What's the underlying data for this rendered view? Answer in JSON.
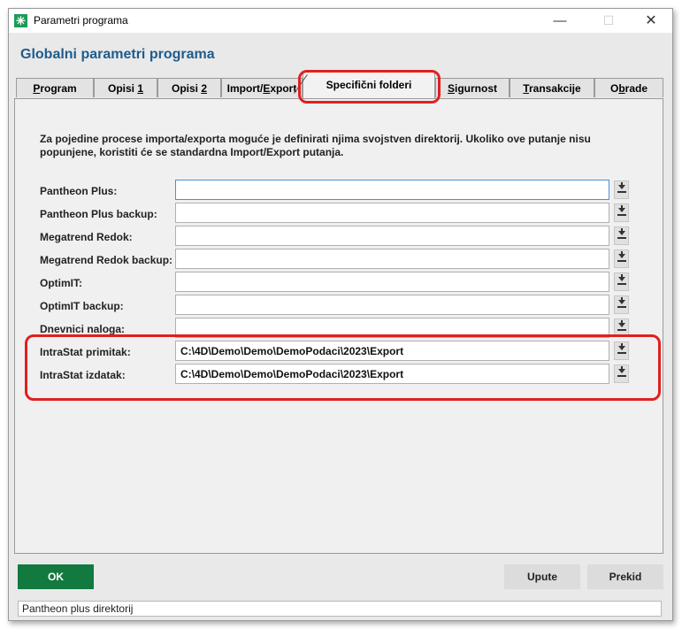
{
  "window": {
    "title": "Parametri programa"
  },
  "header": {
    "title": "Globalni parametri programa"
  },
  "tabs": [
    {
      "pre": "",
      "u": "P",
      "post": "rogram",
      "active": false
    },
    {
      "pre": "Opisi ",
      "u": "1",
      "post": "",
      "active": false
    },
    {
      "pre": "Opisi ",
      "u": "2",
      "post": "",
      "active": false
    },
    {
      "pre": "Import/",
      "u": "E",
      "post": "xport",
      "active": false
    },
    {
      "pre": "Specifični folderi",
      "u": "",
      "post": "",
      "active": true
    },
    {
      "pre": "",
      "u": "S",
      "post": "igurnost",
      "active": false
    },
    {
      "pre": "",
      "u": "T",
      "post": "ransakcije",
      "active": false
    },
    {
      "pre": "O",
      "u": "b",
      "post": "rade",
      "active": false
    }
  ],
  "panel": {
    "description": "Za pojedine procese importa/exporta moguće je definirati  njima svojstven direktorij. Ukoliko ove putanje nisu popunjene, koristiti će se standardna Import/Export putanja.",
    "rows": [
      {
        "label": "Pantheon Plus:",
        "value": ""
      },
      {
        "label": "Pantheon Plus backup:",
        "value": ""
      },
      {
        "label": "Megatrend Redok:",
        "value": ""
      },
      {
        "label": "Megatrend Redok backup:",
        "value": ""
      },
      {
        "label": "OptimIT:",
        "value": ""
      },
      {
        "label": "OptimIT backup:",
        "value": ""
      },
      {
        "label": "Dnevnici naloga:",
        "value": ""
      },
      {
        "label": "IntraStat primitak:",
        "value": "C:\\4D\\Demo\\Demo\\DemoPodaci\\2023\\Export"
      },
      {
        "label": "IntraStat izdatak:",
        "value": "C:\\4D\\Demo\\Demo\\DemoPodaci\\2023\\Export"
      }
    ]
  },
  "buttons": {
    "ok": "OK",
    "upute": "Upute",
    "prekid": "Prekid"
  },
  "status": {
    "text": "Pantheon plus direktorij"
  },
  "colors": {
    "ok_green": "#127a3f",
    "header_blue": "#1f5c8c",
    "highlight_red": "#e02020"
  }
}
